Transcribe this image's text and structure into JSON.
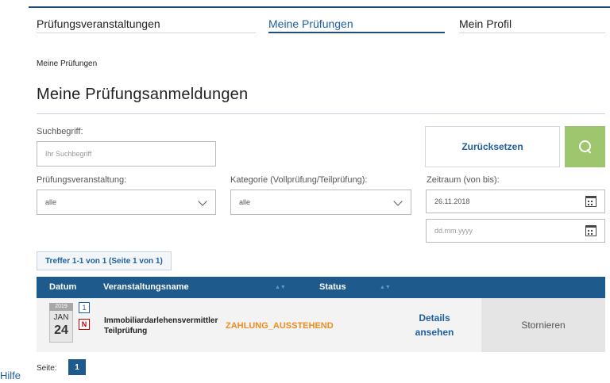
{
  "nav": {
    "items": [
      {
        "label": "Prüfungsveranstaltungen"
      },
      {
        "label": "Meine Prüfungen"
      },
      {
        "label": "Mein Profil"
      }
    ]
  },
  "breadcrumb": "Meine Prüfungen",
  "page_title": "Meine Prüfungsanmeldungen",
  "filters": {
    "search_label": "Suchbegriff:",
    "search_placeholder": "Ihr Suchbegriff",
    "event_label": "Prüfungsveranstaltung:",
    "event_value": "alle",
    "category_label": "Kategorie (Vollprüfung/Teilprüfung):",
    "category_value": "alle",
    "period_label": "Zeitraum (von bis):",
    "period_from": "26.11.2018",
    "period_to_placeholder": "dd.mm.yyyy",
    "reset_label": "Zurücksetzen"
  },
  "results_summary": "Treffer 1-1 von 1 (Seite 1 von 1)",
  "table": {
    "headers": [
      "Datum",
      "Veranstaltungsname",
      "Status"
    ],
    "rows": [
      {
        "year": "2019",
        "month": "JAN",
        "day": "24",
        "badge_count": "1",
        "badge_letter": "N",
        "name_line1": "Immobiliardarlehensvermittler",
        "name_line2": "Teilprüfung",
        "status": "ZAHLUNG_AUSSTEHEND",
        "details_line1": "Details",
        "details_line2": "ansehen",
        "cancel_label": "Stornieren"
      }
    ]
  },
  "pagination": {
    "label": "Seite:",
    "current": "1"
  },
  "help_link": "Hilfe",
  "colors": {
    "primary": "#1f5a8c",
    "search_button": "#9dc66f",
    "status_pending": "#f08c1f",
    "link": "#1f5f9f"
  }
}
